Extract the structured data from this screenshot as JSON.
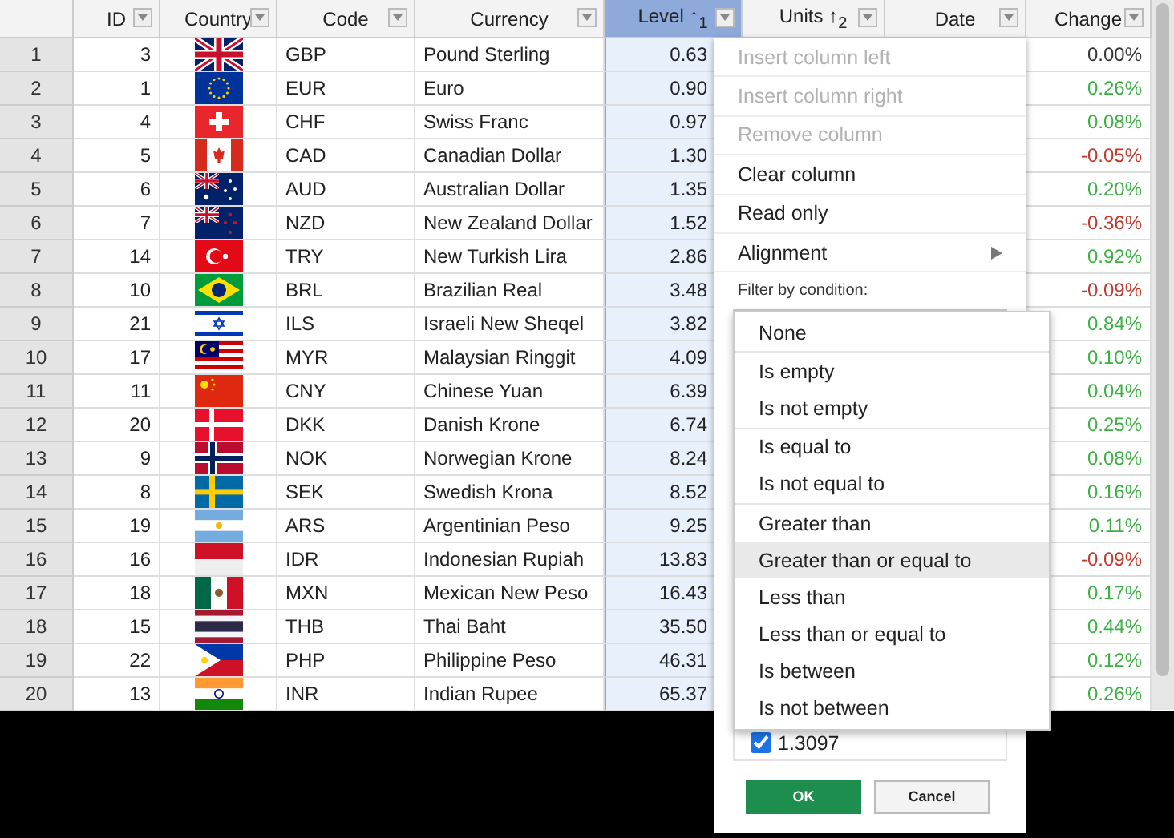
{
  "columns": [
    {
      "label": "ID",
      "selected": false
    },
    {
      "label": "Country",
      "selected": false
    },
    {
      "label": "Code",
      "selected": false
    },
    {
      "label": "Currency",
      "selected": false
    },
    {
      "label": "Level ↑$_{1}$",
      "selected": true
    },
    {
      "label": "Units ↑$_{2}$",
      "selected": false
    },
    {
      "label": "Date",
      "selected": false
    },
    {
      "label": "Change",
      "selected": false
    }
  ],
  "rows": [
    {
      "row_number": "1",
      "id": "3",
      "code": "GBP",
      "currency": "Pound Sterling",
      "level": "0.63",
      "change": "0.00%",
      "color": "#333333"
    },
    {
      "row_number": "2",
      "id": "1",
      "code": "EUR",
      "currency": "Euro",
      "level": "0.90",
      "change": "0.26%",
      "color": "#3cb043"
    },
    {
      "row_number": "3",
      "id": "4",
      "code": "CHF",
      "currency": "Swiss Franc",
      "level": "0.97",
      "change": "0.08%",
      "color": "#3cb043"
    },
    {
      "row_number": "4",
      "id": "5",
      "code": "CAD",
      "currency": "Canadian Dollar",
      "level": "1.30",
      "change": "-0.05%",
      "color": "#c0392b"
    },
    {
      "row_number": "5",
      "id": "6",
      "code": "AUD",
      "currency": "Australian Dollar",
      "level": "1.35",
      "change": "0.20%",
      "color": "#3cb043"
    },
    {
      "row_number": "6",
      "id": "7",
      "code": "NZD",
      "currency": "New Zealand Dollar",
      "level": "1.52",
      "change": "-0.36%",
      "color": "#c0392b"
    },
    {
      "row_number": "7",
      "id": "14",
      "code": "TRY",
      "currency": "New Turkish Lira",
      "level": "2.86",
      "change": "0.92%",
      "color": "#3cb043"
    },
    {
      "row_number": "8",
      "id": "10",
      "code": "BRL",
      "currency": "Brazilian Real",
      "level": "3.48",
      "change": "-0.09%",
      "color": "#c0392b"
    },
    {
      "row_number": "9",
      "id": "21",
      "code": "ILS",
      "currency": "Israeli New Sheqel",
      "level": "3.82",
      "change": "0.84%",
      "color": "#3cb043"
    },
    {
      "row_number": "10",
      "id": "17",
      "code": "MYR",
      "currency": "Malaysian Ringgit",
      "level": "4.09",
      "change": "0.10%",
      "color": "#3cb043"
    },
    {
      "row_number": "11",
      "id": "11",
      "code": "CNY",
      "currency": "Chinese Yuan",
      "level": "6.39",
      "change": "0.04%",
      "color": "#3cb043"
    },
    {
      "row_number": "12",
      "id": "20",
      "code": "DKK",
      "currency": "Danish Krone",
      "level": "6.74",
      "change": "0.25%",
      "color": "#3cb043"
    },
    {
      "row_number": "13",
      "id": "9",
      "code": "NOK",
      "currency": "Norwegian Krone",
      "level": "8.24",
      "change": "0.08%",
      "color": "#3cb043"
    },
    {
      "row_number": "14",
      "id": "8",
      "code": "SEK",
      "currency": "Swedish Krona",
      "level": "8.52",
      "change": "0.16%",
      "color": "#3cb043"
    },
    {
      "row_number": "15",
      "id": "19",
      "code": "ARS",
      "currency": "Argentinian Peso",
      "level": "9.25",
      "change": "0.11%",
      "color": "#3cb043"
    },
    {
      "row_number": "16",
      "id": "16",
      "code": "IDR",
      "currency": "Indonesian Rupiah",
      "level": "13.83",
      "change": "-0.09%",
      "color": "#c0392b"
    },
    {
      "row_number": "17",
      "id": "18",
      "code": "MXN",
      "currency": "Mexican New Peso",
      "level": "16.43",
      "change": "0.17%",
      "color": "#3cb043"
    },
    {
      "row_number": "18",
      "id": "15",
      "code": "THB",
      "currency": "Thai Baht",
      "level": "35.50",
      "change": "0.44%",
      "color": "#3cb043"
    },
    {
      "row_number": "19",
      "id": "22",
      "code": "PHP",
      "currency": "Philippine Peso",
      "level": "46.31",
      "change": "0.12%",
      "color": "#3cb043"
    },
    {
      "row_number": "20",
      "id": "13",
      "code": "INR",
      "currency": "Indian Rupee",
      "level": "65.37",
      "change": "0.26%",
      "color": "#3cb043"
    }
  ],
  "context_menu": {
    "items": [
      {
        "label": "Insert column left",
        "disabled": true,
        "kind": "item"
      },
      {
        "label": "Insert column right",
        "disabled": true,
        "kind": "item"
      },
      {
        "label": "Remove column",
        "disabled": true,
        "kind": "item"
      },
      {
        "label": "Clear column",
        "disabled": false,
        "kind": "item"
      },
      {
        "label": "Read only",
        "disabled": false,
        "kind": "item"
      },
      {
        "label": "Alignment",
        "disabled": false,
        "kind": "submenu"
      }
    ],
    "filter_label": "Filter by condition:",
    "value_list": [
      {
        "label": "1.3097",
        "checked": true
      }
    ],
    "buttons": [
      {
        "label": "OK",
        "kind": "primary"
      },
      {
        "label": "Cancel",
        "kind": "secondary"
      }
    ]
  },
  "condition_dropdown": {
    "options": [
      {
        "label": "None",
        "selected": false,
        "divider_before": false
      },
      {
        "label": "Is empty",
        "selected": false,
        "divider_before": true
      },
      {
        "label": "Is not empty",
        "selected": false,
        "divider_before": false
      },
      {
        "label": "Is equal to",
        "selected": false,
        "divider_before": true
      },
      {
        "label": "Is not equal to",
        "selected": false,
        "divider_before": false
      },
      {
        "label": "Greater than",
        "selected": false,
        "divider_before": true
      },
      {
        "label": "Greater than or equal to",
        "selected": true,
        "divider_before": false
      },
      {
        "label": "Less than",
        "selected": false,
        "divider_before": false
      },
      {
        "label": "Less than or equal to",
        "selected": false,
        "divider_before": false
      },
      {
        "label": "Is between",
        "selected": false,
        "divider_before": false
      },
      {
        "label": "Is not between",
        "selected": false,
        "divider_before": false
      }
    ]
  }
}
